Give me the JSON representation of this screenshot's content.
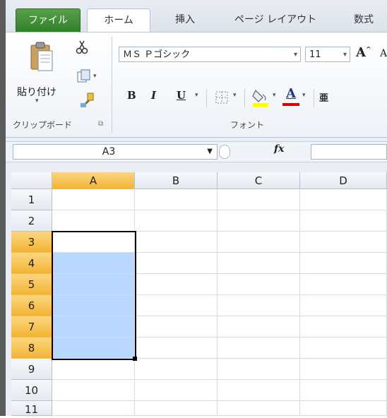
{
  "tabs": [
    {
      "id": "file",
      "label": "ファイル"
    },
    {
      "id": "home",
      "label": "ホーム"
    },
    {
      "id": "insert",
      "label": "挿入"
    },
    {
      "id": "page",
      "label": "ページ レイアウト"
    },
    {
      "id": "formula",
      "label": "数式"
    }
  ],
  "ribbon": {
    "clipboard": {
      "paste_label": "貼り付け",
      "group_label": "クリップボード"
    },
    "font": {
      "font_name": "ＭＳ Ｐゴシック",
      "font_size": "11",
      "bold": "B",
      "italic": "I",
      "underline": "U",
      "group_label": "フォント"
    }
  },
  "formula_bar": {
    "name_box": "A3",
    "fx": "fx",
    "formula": ""
  },
  "sheet": {
    "columns": [
      "A",
      "B",
      "C",
      "D"
    ],
    "rows": [
      "1",
      "2",
      "3",
      "4",
      "5",
      "6",
      "7",
      "8",
      "9",
      "10",
      "11"
    ],
    "active_cell": "A3",
    "selection": "A3:A8"
  },
  "colors": {
    "file_tab": "#3a8a33",
    "selected_header": "#f5c04a",
    "selection_fill": "#b9d7ff",
    "font_color_bar": "#e00000",
    "highlight_bar": "#ffff00"
  }
}
